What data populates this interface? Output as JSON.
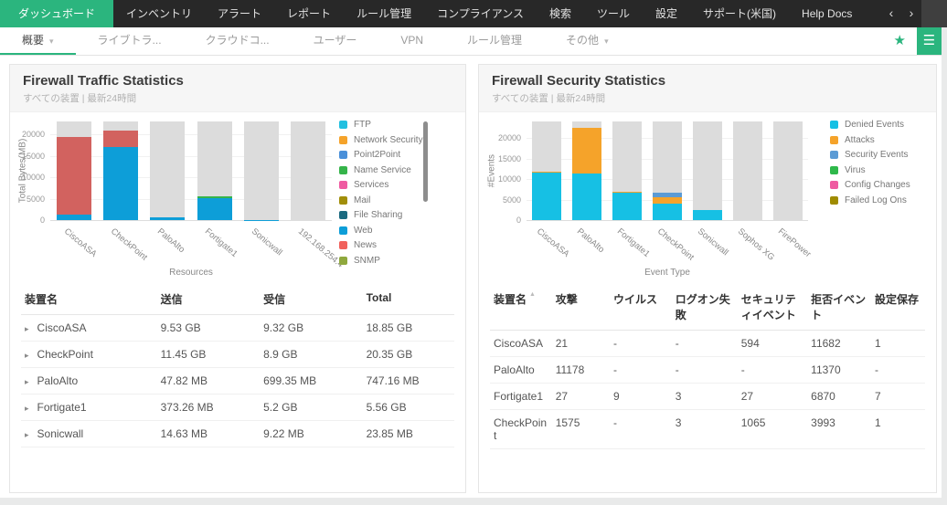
{
  "topnav": {
    "items": [
      {
        "label": "ダッシュボード",
        "active": true
      },
      {
        "label": "インベントリ",
        "active": false
      },
      {
        "label": "アラート",
        "active": false
      },
      {
        "label": "レポート",
        "active": false
      },
      {
        "label": "ルール管理",
        "active": false
      },
      {
        "label": "コンプライアンス",
        "active": false
      },
      {
        "label": "検索",
        "active": false
      },
      {
        "label": "ツール",
        "active": false
      },
      {
        "label": "設定",
        "active": false
      },
      {
        "label": "サポート(米国)",
        "active": false
      },
      {
        "label": "Help Docs",
        "active": false
      }
    ],
    "scroll_left": "‹",
    "scroll_right": "›"
  },
  "subnav": {
    "items": [
      {
        "label": "概要",
        "active": true,
        "chevron": true
      },
      {
        "label": "ライブトラ...",
        "active": false,
        "chevron": false
      },
      {
        "label": "クラウドコ...",
        "active": false,
        "chevron": false
      },
      {
        "label": "ユーザー",
        "active": false,
        "chevron": false
      },
      {
        "label": "VPN",
        "active": false,
        "chevron": false
      },
      {
        "label": "ルール管理",
        "active": false,
        "chevron": false
      },
      {
        "label": "その他",
        "active": false,
        "chevron": true
      }
    ],
    "star_icon": "★",
    "menu_icon": "☰"
  },
  "colors": {
    "accent": "#2bb57e",
    "nav_bg": "#282828",
    "bar_track_gray": "#dcdcdc"
  },
  "panels": [
    {
      "title": "Firewall Traffic Statistics",
      "subtitle": "すべての装置 | 最新24時間",
      "chart_data": {
        "type": "bar",
        "stacked": true,
        "xlabel": "Resources",
        "ylabel": "Total Bytes(MB)",
        "ylim": [
          0,
          23000
        ],
        "yticks": [
          0,
          5000,
          10000,
          15000,
          20000
        ],
        "grid": true,
        "legend_position": "right",
        "legend_scrollbar": true,
        "categories": [
          "CiscoASA",
          "CheckPoint",
          "PaloAlto",
          "Fortigate1",
          "Sonicwall",
          "192.168.254.4"
        ],
        "series": [
          {
            "name": "Web",
            "color": "#0d9ed8",
            "values": [
              1300,
              17000,
              600,
              5100,
              20,
              0
            ]
          },
          {
            "name": "News",
            "color": "#d2625f",
            "values": [
              18000,
              3800,
              0,
              0,
              0,
              0
            ]
          },
          {
            "name": "Name Service",
            "color": "#35b44a",
            "values": [
              0,
              0,
              0,
              420,
              0,
              0
            ]
          }
        ],
        "background_track_max": 23000,
        "legend": [
          {
            "label": "FTP",
            "color": "#22c0e0"
          },
          {
            "label": "Network Security",
            "color": "#f5a32a"
          },
          {
            "label": "Point2Point",
            "color": "#4a90d9"
          },
          {
            "label": "Name Service",
            "color": "#35b44a"
          },
          {
            "label": "Services",
            "color": "#ef5ba1"
          },
          {
            "label": "Mail",
            "color": "#a18e0a"
          },
          {
            "label": "File Sharing",
            "color": "#1a6a80"
          },
          {
            "label": "Web",
            "color": "#0d9ed8"
          },
          {
            "label": "News",
            "color": "#f1615c"
          },
          {
            "label": "SNMP",
            "color": "#8fa83d"
          }
        ]
      },
      "table": {
        "expandable": true,
        "row_icon": "▸",
        "headers": [
          "装置名",
          "送信",
          "受信",
          "Total"
        ],
        "rows": [
          [
            "CiscoASA",
            "9.53 GB",
            "9.32 GB",
            "18.85 GB"
          ],
          [
            "CheckPoint",
            "11.45 GB",
            "8.9 GB",
            "20.35 GB"
          ],
          [
            "PaloAlto",
            "47.82 MB",
            "699.35 MB",
            "747.16 MB"
          ],
          [
            "Fortigate1",
            "373.26 MB",
            "5.2 GB",
            "5.56 GB"
          ],
          [
            "Sonicwall",
            "14.63 MB",
            "9.22 MB",
            "23.85 MB"
          ]
        ]
      }
    },
    {
      "title": "Firewall Security Statistics",
      "subtitle": "すべての装置 | 最新24時間",
      "chart_data": {
        "type": "bar",
        "stacked": true,
        "xlabel": "Event Type",
        "ylabel": "#Events",
        "ylim": [
          0,
          24000
        ],
        "yticks": [
          0,
          5000,
          10000,
          15000,
          20000
        ],
        "grid": true,
        "legend_position": "right",
        "legend_scrollbar": false,
        "categories": [
          "CiscoASA",
          "PaloAlto",
          "Fortigate1",
          "CheckPoint",
          "Sonicwall",
          "Sophos XG",
          "FirePower"
        ],
        "series": [
          {
            "name": "Denied Events",
            "color": "#16c0e4",
            "values": [
              11682,
              11370,
              6870,
              3993,
              2500,
              0,
              0
            ]
          },
          {
            "name": "Attacks",
            "color": "#f5a32a",
            "values": [
              21,
              11178,
              27,
              1575,
              0,
              0,
              0
            ]
          },
          {
            "name": "Security Events",
            "color": "#5b9bd5",
            "values": [
              0,
              0,
              0,
              1065,
              0,
              0,
              0
            ]
          }
        ],
        "background_track_max": 24000,
        "legend": [
          {
            "label": "Denied Events",
            "color": "#16c0e4"
          },
          {
            "label": "Attacks",
            "color": "#f5a32a"
          },
          {
            "label": "Security Events",
            "color": "#5b9bd5"
          },
          {
            "label": "Virus",
            "color": "#2eb84a"
          },
          {
            "label": "Config Changes",
            "color": "#ef5ba1"
          },
          {
            "label": "Failed Log Ons",
            "color": "#9f8b00"
          }
        ]
      },
      "table": {
        "expandable": false,
        "sorted_header": 0,
        "sort_icon": "▲",
        "headers": [
          "装置名",
          "攻撃",
          "ウイルス",
          "ログオン失敗",
          "セキュリティイベント",
          "拒否イベント",
          "設定保存"
        ],
        "rows": [
          [
            "CiscoASA",
            "21",
            "-",
            "-",
            "594",
            "11682",
            "1"
          ],
          [
            "PaloAlto",
            "11178",
            "-",
            "-",
            "-",
            "11370",
            "-"
          ],
          [
            "Fortigate1",
            "27",
            "9",
            "3",
            "27",
            "6870",
            "7"
          ],
          [
            "CheckPoint",
            "1575",
            "-",
            "3",
            "1065",
            "3993",
            "1"
          ]
        ]
      }
    }
  ]
}
